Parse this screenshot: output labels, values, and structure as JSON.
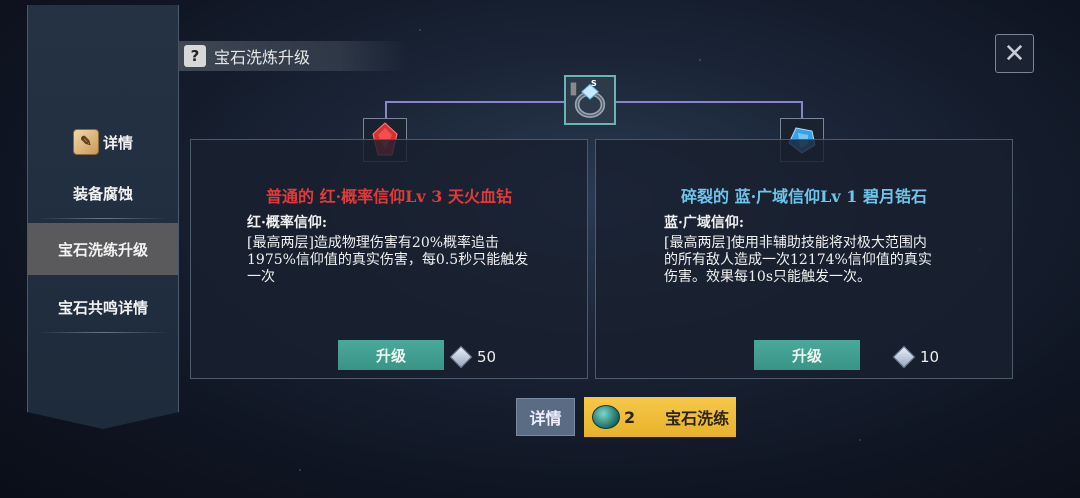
{
  "header": {
    "title": "宝石洗炼升级",
    "help_icon": "?"
  },
  "sidebar": {
    "detail_tab": {
      "label": "详情",
      "icon": "scroll-icon"
    },
    "items": [
      {
        "label": "装备腐蚀",
        "active": false
      },
      {
        "label": "宝石洗练升级",
        "active": true
      },
      {
        "label": "宝石共鸣详情",
        "active": false
      }
    ]
  },
  "close_icon": "✕",
  "panels": [
    {
      "title": "普通的 红·概率信仰Lv 3 天火血钻",
      "title_color": "#e03a3a",
      "gem_icon": "red-gem-icon",
      "subtitle": "红·概率信仰:",
      "description": "[最高两层]造成物理伤害有20%概率追击1975%信仰值的真实伤害，每0.5秒只能触发一次",
      "button_label": "升级",
      "cost": "50"
    },
    {
      "title": "碎裂的 蓝·广域信仰Lv 1 碧月锆石",
      "title_color": "#6ec4ea",
      "gem_icon": "blue-gem-icon",
      "subtitle": "蓝·广域信仰:",
      "description": "[最高两层]使用非辅助技能将对极大范围内的所有敌人造成一次12174%信仰值的真实伤害。效果每10s只能触发一次。",
      "button_label": "升级",
      "cost": "10"
    }
  ],
  "center_item": {
    "icon": "ring-icon",
    "grade": "S"
  },
  "bottom": {
    "detail_label": "详情",
    "wash_count": "2",
    "wash_label": "宝石洗练"
  },
  "colors": {
    "accent_green": "#3a9486",
    "accent_gold": "#f0be3a",
    "connector": "#8a84c8"
  }
}
